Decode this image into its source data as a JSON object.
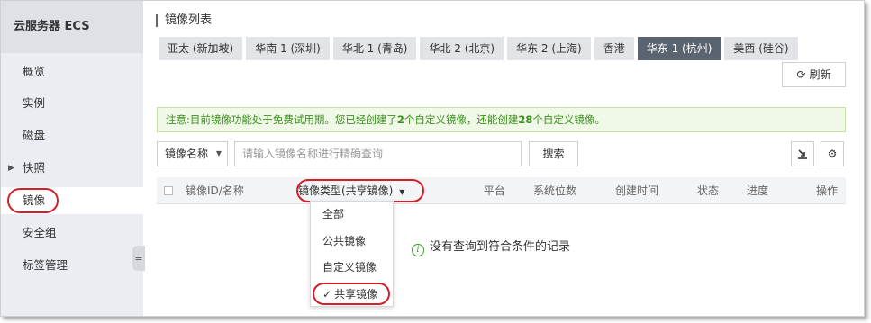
{
  "sidebar": {
    "title": "云服务器 ECS",
    "items": [
      {
        "label": "概览"
      },
      {
        "label": "实例"
      },
      {
        "label": "磁盘"
      },
      {
        "label": "快照"
      },
      {
        "label": "镜像"
      },
      {
        "label": "安全组"
      },
      {
        "label": "标签管理"
      }
    ],
    "active_item": "镜像"
  },
  "header": {
    "title": "镜像列表"
  },
  "regions": [
    {
      "label": "亚太 (新加坡)"
    },
    {
      "label": "华南 1 (深圳)"
    },
    {
      "label": "华北 1 (青岛)"
    },
    {
      "label": "华北 2 (北京)"
    },
    {
      "label": "华东 2 (上海)"
    },
    {
      "label": "香港"
    },
    {
      "label": "华东 1 (杭州)"
    },
    {
      "label": "美西 (硅谷)"
    }
  ],
  "active_region": "华东 1 (杭州)",
  "toolbar": {
    "refresh_label": "刷新"
  },
  "notice": {
    "prefix": "注意:目前镜像功能处于免费试用期。您已经创建了",
    "created_count": "2",
    "middle": "个自定义镜像，还能创建",
    "remaining_count": "28",
    "suffix": "个自定义镜像。"
  },
  "search": {
    "field_select": "镜像名称",
    "placeholder": "请输入镜像名称进行精确查询",
    "value": "",
    "button_label": "搜索"
  },
  "table": {
    "columns": {
      "id_name": "镜像ID/名称",
      "type_filter": "镜像类型(共享镜像)",
      "platform": "平台",
      "bits": "系统位数",
      "created": "创建时间",
      "status": "状态",
      "progress": "进度",
      "actions": "操作"
    },
    "empty_message": "没有查询到符合条件的记录"
  },
  "type_dropdown": {
    "options": [
      "全部",
      "公共镜像",
      "自定义镜像",
      "共享镜像"
    ],
    "selected": "共享镜像"
  },
  "colors": {
    "highlight_oval": "#d21f2a",
    "active_tab": "#5a6471",
    "notice_text": "#3a8f1a",
    "sidebar_bg": "#eaedf1"
  }
}
